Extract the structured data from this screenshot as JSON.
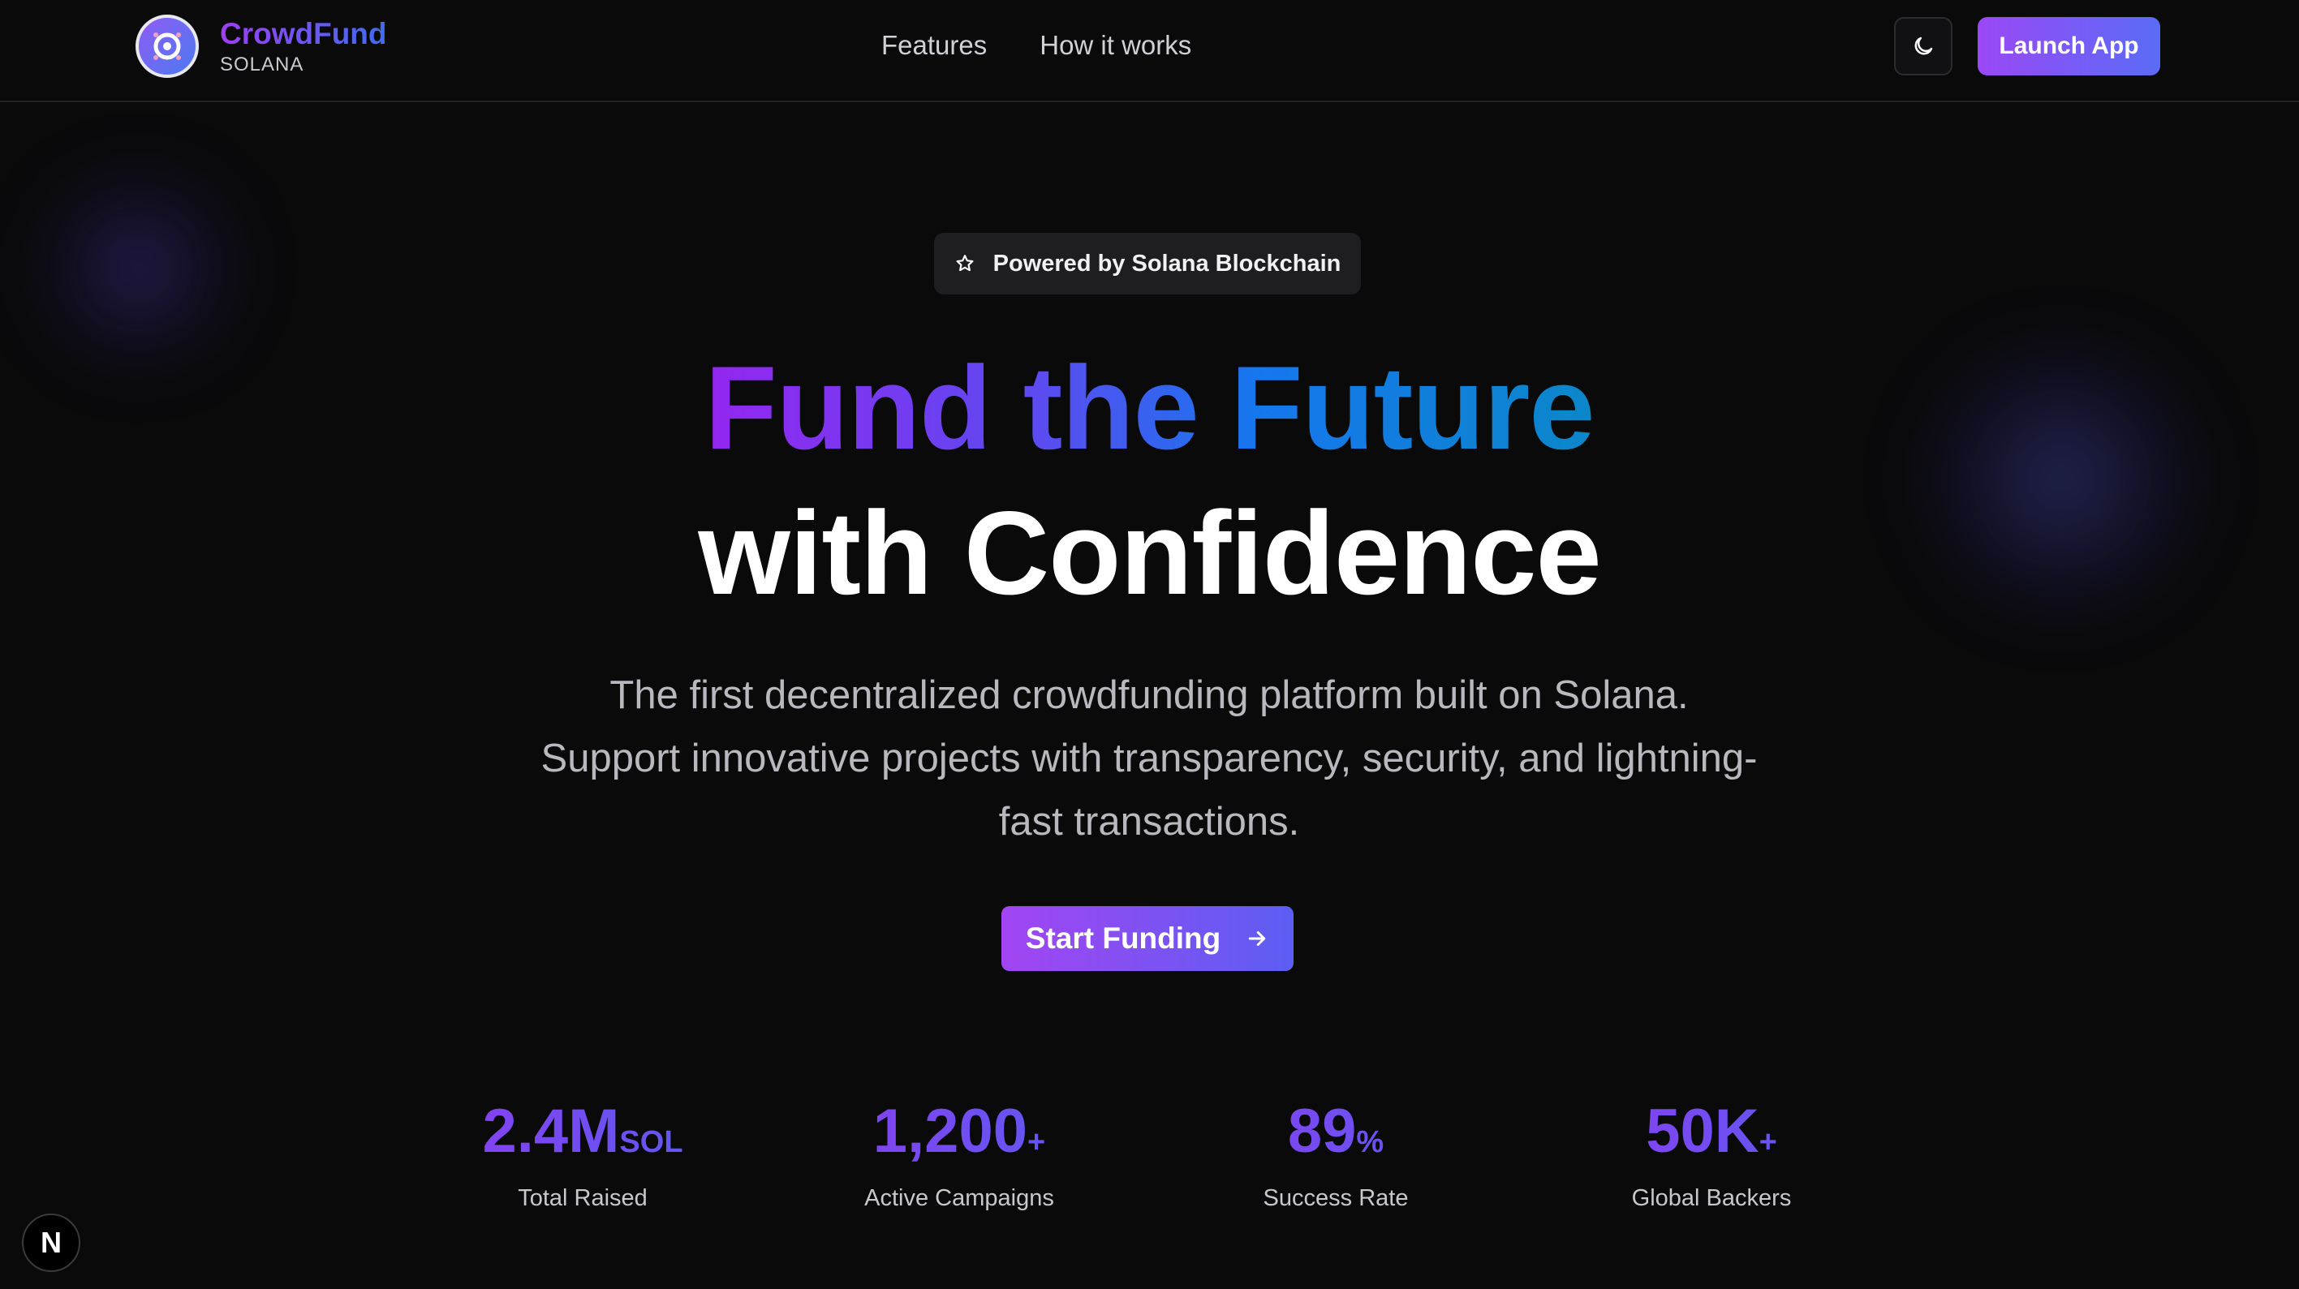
{
  "header": {
    "brand_name": "CrowdFund",
    "brand_sub": "SOLANA",
    "nav": [
      "Features",
      "How it works"
    ],
    "theme_icon": "moon-icon",
    "launch_label": "Launch App"
  },
  "hero": {
    "badge_icon": "star-icon",
    "badge_text": "Powered by Solana Blockchain",
    "headline_gradient": "Fund the Future",
    "headline_plain": "with Confidence",
    "lede": "The first decentralized crowdfunding platform built on Solana. Support innovative projects with transparency, security, and lightning-fast transactions.",
    "cta_label": "Start Funding",
    "cta_icon": "arrow-right-icon"
  },
  "stats": [
    {
      "value": "2.4M",
      "suffix": "SOL",
      "label": "Total Raised"
    },
    {
      "value": "1,200",
      "suffix": "+",
      "label": "Active Campaigns"
    },
    {
      "value": "89",
      "suffix": "%",
      "label": "Success Rate"
    },
    {
      "value": "50K",
      "suffix": "+",
      "label": "Global Backers"
    }
  ],
  "dev_badge": "N",
  "colors": {
    "background": "#0a0a0b",
    "accent_purple": "#9a48f5",
    "accent_blue": "#1577ee"
  }
}
